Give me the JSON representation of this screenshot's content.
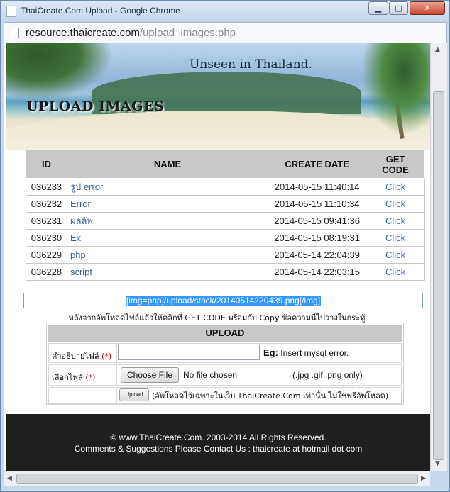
{
  "window": {
    "title": "ThaiCreate.Com Upload - Google Chrome",
    "min_label": "▁",
    "max_label": "□",
    "close_label": "✕"
  },
  "address": {
    "host": "resource.thaicreate.com",
    "path": "/upload_images.php"
  },
  "banner": {
    "tagline": "Unseen in Thailand.",
    "title": "UPLOAD IMAGES"
  },
  "table": {
    "headers": [
      "ID",
      "NAME",
      "CREATE DATE",
      "GET CODE"
    ],
    "rows": [
      {
        "id": "036233",
        "name": "รูป error",
        "date": "2014-05-15 11:40:14",
        "code": "Click"
      },
      {
        "id": "036232",
        "name": "Error",
        "date": "2014-05-15 11:10:34",
        "code": "Click"
      },
      {
        "id": "036231",
        "name": "ผลลัพ",
        "date": "2014-05-15 09:41:36",
        "code": "Click"
      },
      {
        "id": "036230",
        "name": "Ex",
        "date": "2014-05-15 08:19:31",
        "code": "Click"
      },
      {
        "id": "036229",
        "name": "php",
        "date": "2014-05-14 22:04:39",
        "code": "Click"
      },
      {
        "id": "036228",
        "name": "script",
        "date": "2014-05-14 22:03:15",
        "code": "Click"
      }
    ]
  },
  "code_box": {
    "value": "[img=php]/upload/stock/20140514220439.png[/img]"
  },
  "hint": "หลังจากอัพโหลดไฟล์แล้วให้คลิกที่ GET CODE พร้อมกับ Copy ข้อความนี้ไปวางในกระทู้",
  "form": {
    "heading": "UPLOAD",
    "desc_label": "คำอธิบายไฟล์",
    "required_mark": "(*)",
    "eg_label": "Eg:",
    "eg_text": "Insert mysql error.",
    "file_label": "เลือกไฟล์",
    "choose_label": "Choose File",
    "no_file": "No file chosen",
    "types": "(.jpg .gif .png only)",
    "upload_label": "Upload",
    "note": "(อัพโหลดไว้เฉพาะในเว็บ ThaiCreate.Com เท่านั้น ไม่ใช่ฟรีอัพโหลด)"
  },
  "footer": {
    "line1": "© www.ThaiCreate.Com. 2003-2014 All Rights Reserved.",
    "line2": "Comments & Suggestions Please Contact Us : thaicreate at hotmail dot com"
  }
}
